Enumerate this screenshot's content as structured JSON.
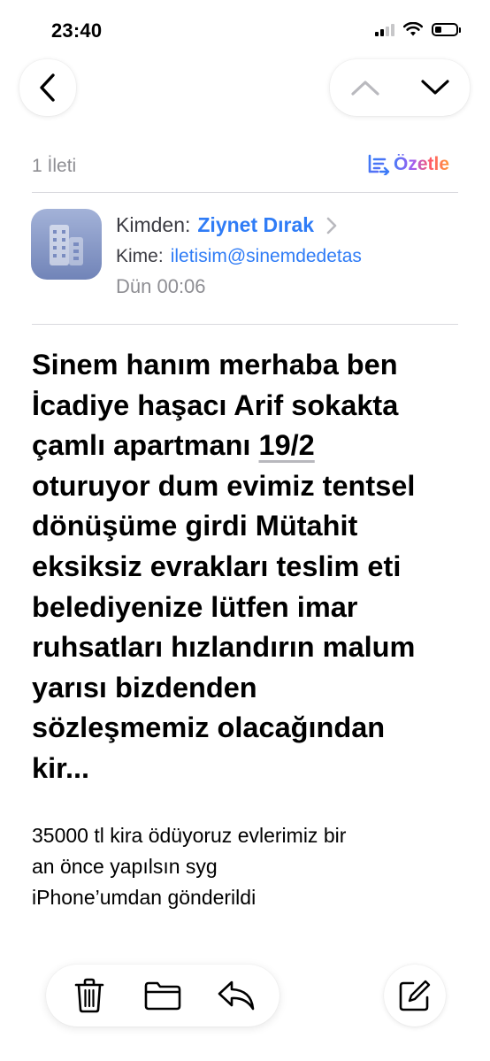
{
  "status_bar": {
    "time": "23:40"
  },
  "thread": {
    "count_label": "1 İleti",
    "summarize_label": "Özetle"
  },
  "header": {
    "from_label": "Kimden:",
    "from_name": "Ziynet Dırak",
    "to_label": "Kime:",
    "to_address": "iletisim@sinemdedetas",
    "date": "Dün 00:06"
  },
  "message": {
    "subject_lines": [
      "Sinem hanım merhaba ben",
      "İcadiye haşacı Arif sokakta",
      "çamlı apartmanı ",
      "19/2",
      "oturuyor dum evimiz tentsel",
      "dönüşüme girdi Mütahit",
      "eksiksiz evrakları teslim eti",
      "belediyenize lütfen imar",
      "ruhsatları hızlandırın malum",
      "yarısı bizdenden",
      "sözleşmemiz olacağından",
      "kir..."
    ],
    "body_lines": [
      "35000 tl kira ödüyoruz evlerimiz bir",
      "an önce yapılsın syg",
      "iPhone’umdan gönderildi"
    ]
  },
  "toolbar": {
    "icons": [
      "trash-icon",
      "folder-icon",
      "reply-icon",
      "compose-icon"
    ]
  }
}
